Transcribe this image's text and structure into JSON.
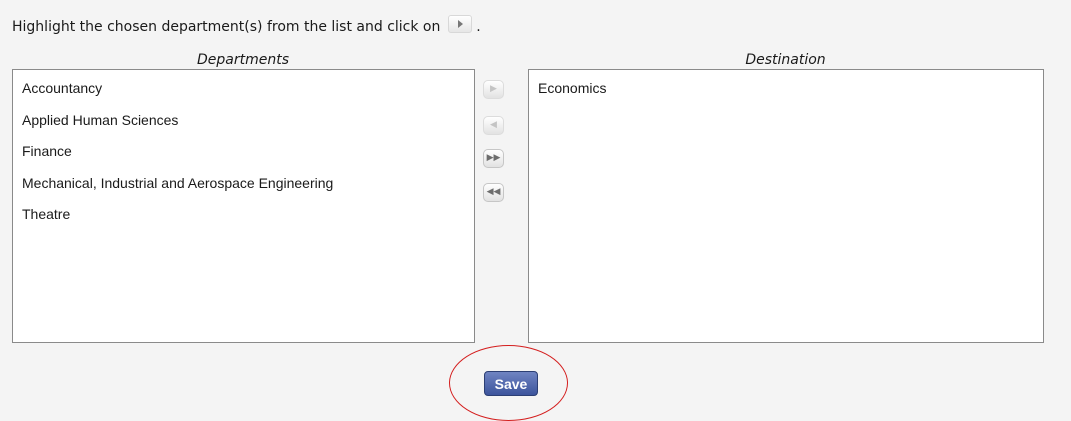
{
  "instruction": {
    "text": "Highlight the chosen department(s) from the list and click on",
    "end_punctuation": ".",
    "inline_icon": "move-right-icon"
  },
  "departments": {
    "heading": "Departments",
    "items": [
      {
        "label": "Accountancy"
      },
      {
        "label": "Applied Human Sciences"
      },
      {
        "label": "Finance"
      },
      {
        "label": "Mechanical, Industrial and Aerospace Engineering"
      },
      {
        "label": "Theatre"
      }
    ]
  },
  "destination": {
    "heading": "Destination",
    "items": [
      {
        "label": "Economics"
      }
    ]
  },
  "transfer_buttons": [
    {
      "name": "move-right-button",
      "glyph": "▶",
      "enabled": false
    },
    {
      "name": "move-left-button",
      "glyph": "◀",
      "enabled": false
    },
    {
      "name": "move-all-right-button",
      "glyph": "▶▶",
      "enabled": true
    },
    {
      "name": "move-all-left-button",
      "glyph": "◀◀",
      "enabled": true
    }
  ],
  "save_label": "Save",
  "colors": {
    "save_button": "#4a62a8",
    "annotation_circle": "#d41e1e",
    "page_background": "#f4f4f4"
  }
}
